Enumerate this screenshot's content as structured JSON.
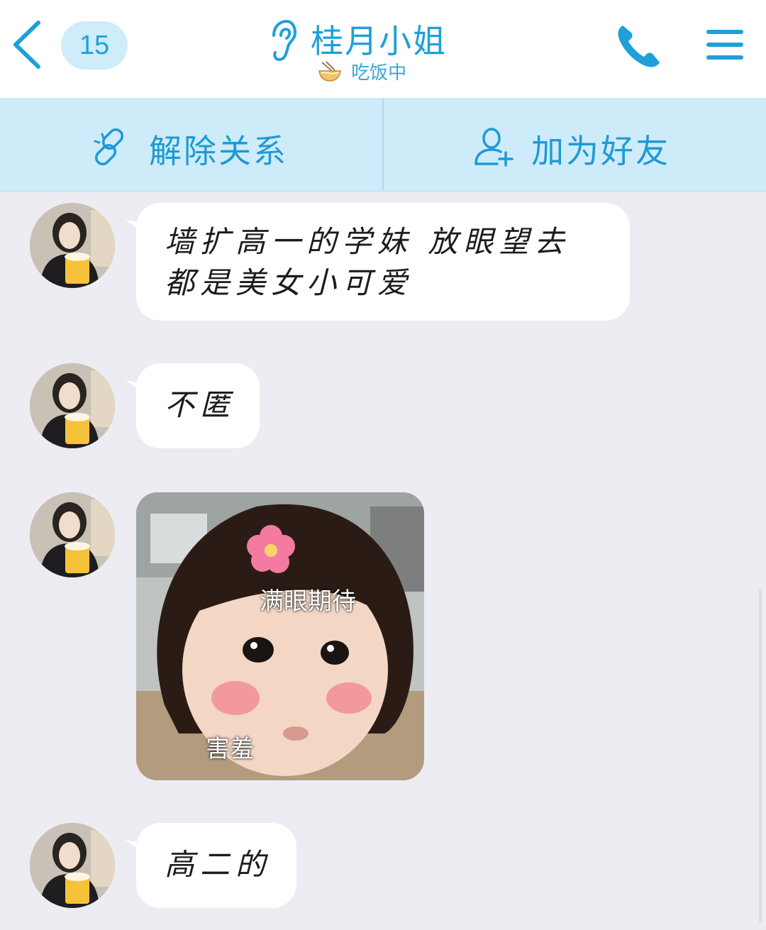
{
  "header": {
    "unread_count": "15",
    "contact_name": "桂月小姐",
    "status": "吃饭中"
  },
  "actions": {
    "remove_relation": "解除关系",
    "add_friend": "加为好友"
  },
  "messages": [
    {
      "type": "text",
      "lines": [
        "墙扩高一的学妹 放眼望去",
        "都是美女小可爱"
      ]
    },
    {
      "type": "text",
      "lines": [
        "不匿"
      ]
    },
    {
      "type": "sticker",
      "captions": {
        "top": "满眼期待",
        "bottom": "害羞"
      }
    },
    {
      "type": "text",
      "lines": [
        "高二的"
      ]
    }
  ],
  "colors": {
    "accent": "#1ea0d8",
    "action_bar": "#cdebf8",
    "chat_background": "#ececf2",
    "bubble": "#ffffff"
  }
}
